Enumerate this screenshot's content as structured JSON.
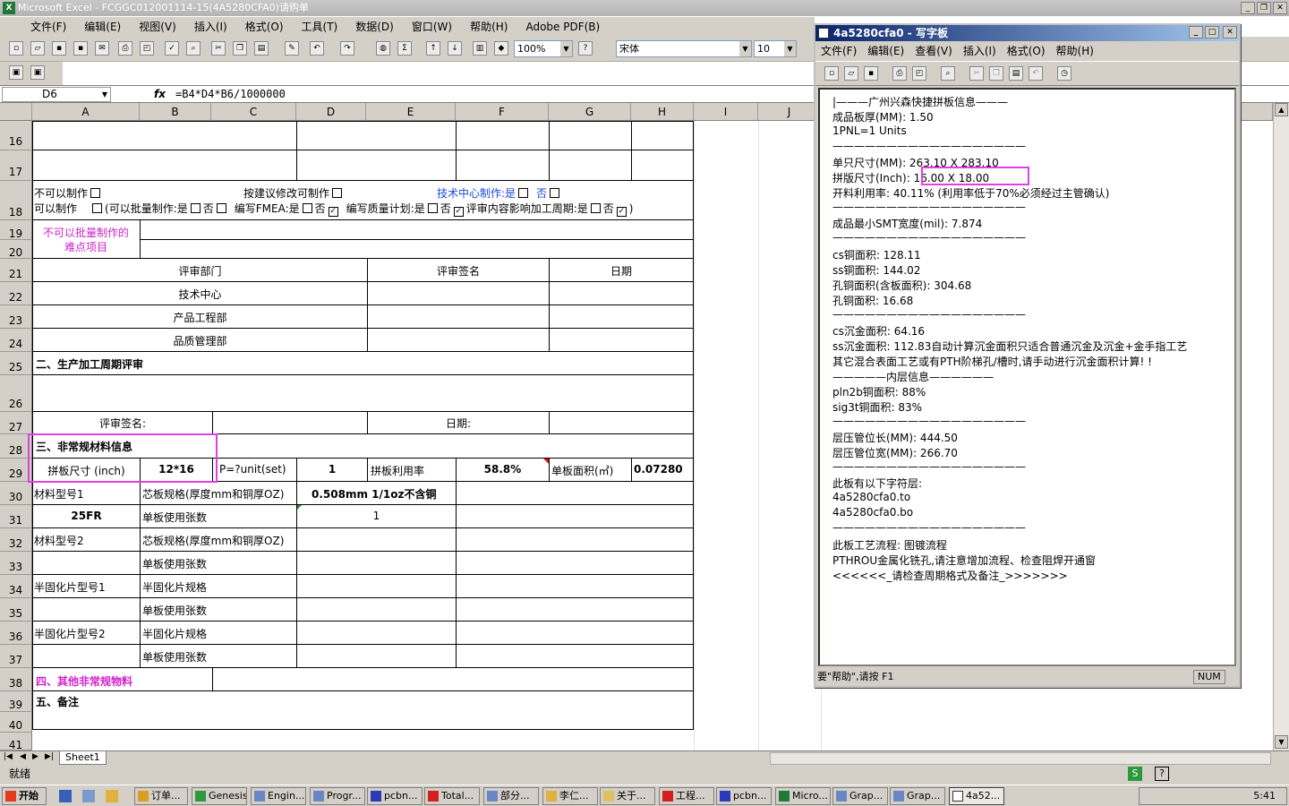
{
  "excel": {
    "title": "Microsoft Excel - FCGGC012001114-15(4A5280CFA0)请购单",
    "menu": [
      "文件(F)",
      "编辑(E)",
      "视图(V)",
      "插入(I)",
      "格式(O)",
      "工具(T)",
      "数据(D)",
      "窗口(W)",
      "帮助(H)",
      "Adobe PDF(B)"
    ],
    "zoom": "100%",
    "font": "宋体",
    "font_size": "10",
    "name_box": "D6",
    "fx_label": "fx",
    "formula": "=B4*D4*B6/1000000",
    "columns": [
      "A",
      "B",
      "C",
      "D",
      "E",
      "F",
      "G",
      "H",
      "I",
      "J"
    ],
    "rows": [
      "16",
      "17",
      "18",
      "19",
      "20",
      "21",
      "22",
      "23",
      "24",
      "25",
      "26",
      "27",
      "28",
      "29",
      "30",
      "31",
      "32",
      "33",
      "34",
      "35",
      "36",
      "37",
      "38",
      "39",
      "40",
      "41"
    ],
    "sheet_tab": "Sheet1",
    "status": "就绪",
    "cells": {
      "r18a_1": "不可以制作",
      "r18a_2": "可以制作",
      "r18_batch": "(可以批量制作:是",
      "r18_no": "否",
      "r18_fmea": "编写FMEA:是",
      "r18_no2": "否",
      "r18_quality": "编写质量计划:是",
      "r18_no3": "否",
      "r18_cycle": "评审内容影响加工周期:是",
      "r18_no4": "否",
      "r18_close": ")",
      "r18_modify": "按建议修改可制作",
      "r18_tech": "技术中心制作:是",
      "r18_tech_no": "否",
      "r19_20": "不可以批量制作的\n难点项目",
      "r21_dept": "评审部门",
      "r21_sign": "评审签名",
      "r21_date": "日期",
      "r22": "技术中心",
      "r23": "产品工程部",
      "r24": "品质管理部",
      "r25": "二、生产加工周期评审",
      "r27_sign": "评审签名:",
      "r27_date": "日期:",
      "r28": "三、非常规材料信息",
      "r29_label": "拼板尺寸 (inch)",
      "r29_value": "12*16",
      "r29_punit": "P=?unit(set)",
      "r29_punit_val": "1",
      "r29_util": "拼板利用率",
      "r29_util_val": "58.8%",
      "r29_area": "单板面积(㎡)",
      "r29_area_val": "0.07280",
      "r30_mat": "材料型号1",
      "r30_core": "芯板规格(厚度mm和铜厚OZ)",
      "r30_core_val": "0.508mm  1/1oz不含铜",
      "r31_mat_val": "25FR",
      "r31_count": "单板使用张数",
      "r31_count_val": "1",
      "r32_mat": "材料型号2",
      "r32_core": "芯板规格(厚度mm和铜厚OZ)",
      "r33_count": "单板使用张数",
      "r34_pp": "半固化片型号1",
      "r34_spec": "半固化片规格",
      "r35_count": "单板使用张数",
      "r36_pp": "半固化片型号2",
      "r36_spec": "半固化片规格",
      "r37_count": "单板使用张数",
      "r38": "四、其他非常规物料",
      "r39": "五、备注"
    }
  },
  "wordpad": {
    "title": "4a5280cfa0 - 写字板",
    "menu": [
      "文件(F)",
      "编辑(E)",
      "查看(V)",
      "插入(I)",
      "格式(O)",
      "帮助(H)"
    ],
    "lines": [
      "|———广州兴森快捷拼板信息———",
      "成品板厚(MM): 1.50",
      "1PNL=1 Units",
      "——————————————————",
      "单只尺寸(MM): 263.10 X 283.10",
      "拼版尺寸(Inch): 16.00 X 18.00",
      "开料利用率: 40.11% (利用率低于70%必须经过主管确认)",
      "——————————————————",
      "成品最小SMT宽度(mil): 7.874",
      "——————————————————",
      "cs铜面积: 128.11",
      "ss铜面积: 144.02",
      "孔铜面积(含板面积): 304.68",
      "孔铜面积: 16.68",
      "——————————————————",
      "cs沉金面积: 64.16",
      "ss沉金面积: 112.83自动计算沉金面积只适合普通沉金及沉金+金手指工艺",
      "其它混合表面工艺或有PTH阶梯孔/槽时,请手动进行沉金面积计算! !",
      "—————内层信息——————",
      "pln2b铜面积: 88%",
      "sig3t铜面积: 83%",
      "——————————————————",
      "层压管位长(MM): 444.50",
      "层压管位宽(MM): 266.70",
      "——————————————————",
      "此板有以下字符层:",
      "4a5280cfa0.to",
      "4a5280cfa0.bo",
      "——————————————————",
      "此板工艺流程: 图镀流程",
      "PTHROU金属化铣孔,请注意增加流程、检查阻焊开通窗",
      "<<<<<<_请检查周期格式及备注_>>>>>>>"
    ],
    "status_help": "要\"帮助\",请按 F1",
    "status_num": "NUM"
  },
  "taskbar": {
    "start": "开始",
    "tasks": [
      "订单...",
      "Genesis",
      "Engin...",
      "Progr...",
      "pcbn...",
      "Total...",
      "部分...",
      "李仁...",
      "关于...",
      "工程...",
      "pcbn...",
      "Micro...",
      "Grap...",
      "Grap...",
      "4a52..."
    ],
    "clock": "5:41"
  },
  "colors": {
    "highlight": "#e040e0",
    "magenta_text": "#d020d0",
    "blue_text": "#1a4bd8",
    "wordpad_title": "#0a246a"
  }
}
